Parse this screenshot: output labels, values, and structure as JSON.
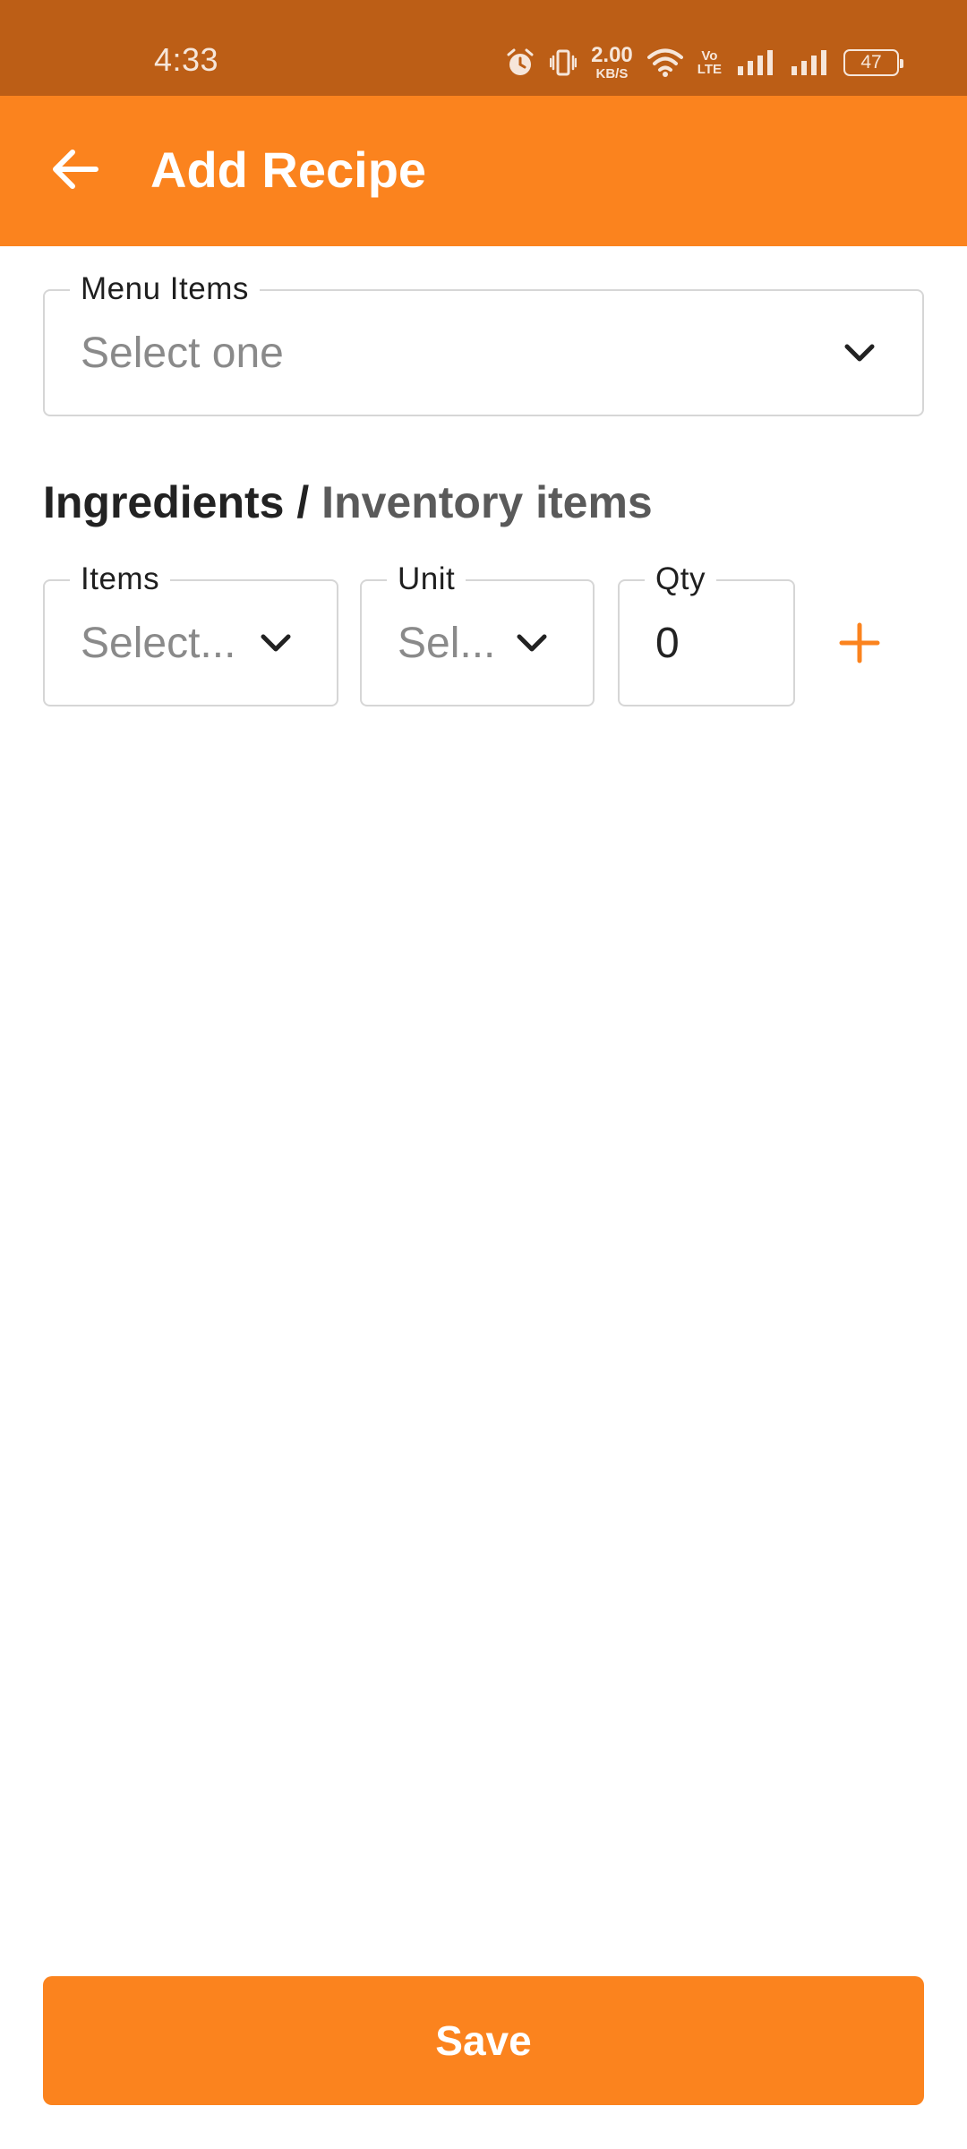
{
  "status_bar": {
    "time": "4:33",
    "net_speed_value": "2.00",
    "net_speed_unit": "KB/S",
    "volte_top": "Vo",
    "volte_bottom": "LTE",
    "battery": "47"
  },
  "app_bar": {
    "title": "Add Recipe"
  },
  "menu_items_field": {
    "label": "Menu Items",
    "placeholder": "Select one"
  },
  "ingredients_section": {
    "title": "Ingredients /",
    "subtitle": "Inventory items"
  },
  "ingredient_row": {
    "items": {
      "label": "Items",
      "placeholder": "Select..."
    },
    "unit": {
      "label": "Unit",
      "placeholder": "Sel..."
    },
    "qty": {
      "label": "Qty",
      "value": "0"
    }
  },
  "save_button": {
    "label": "Save"
  },
  "colors": {
    "status_bar": "#BC5E16",
    "accent": "#FB831E",
    "field_border": "#D6D6D6"
  },
  "icons": [
    "alarm-icon",
    "vibrate-icon",
    "wifi-icon",
    "signal-icon",
    "back-arrow-icon",
    "chevron-down-icon",
    "plus-icon"
  ]
}
